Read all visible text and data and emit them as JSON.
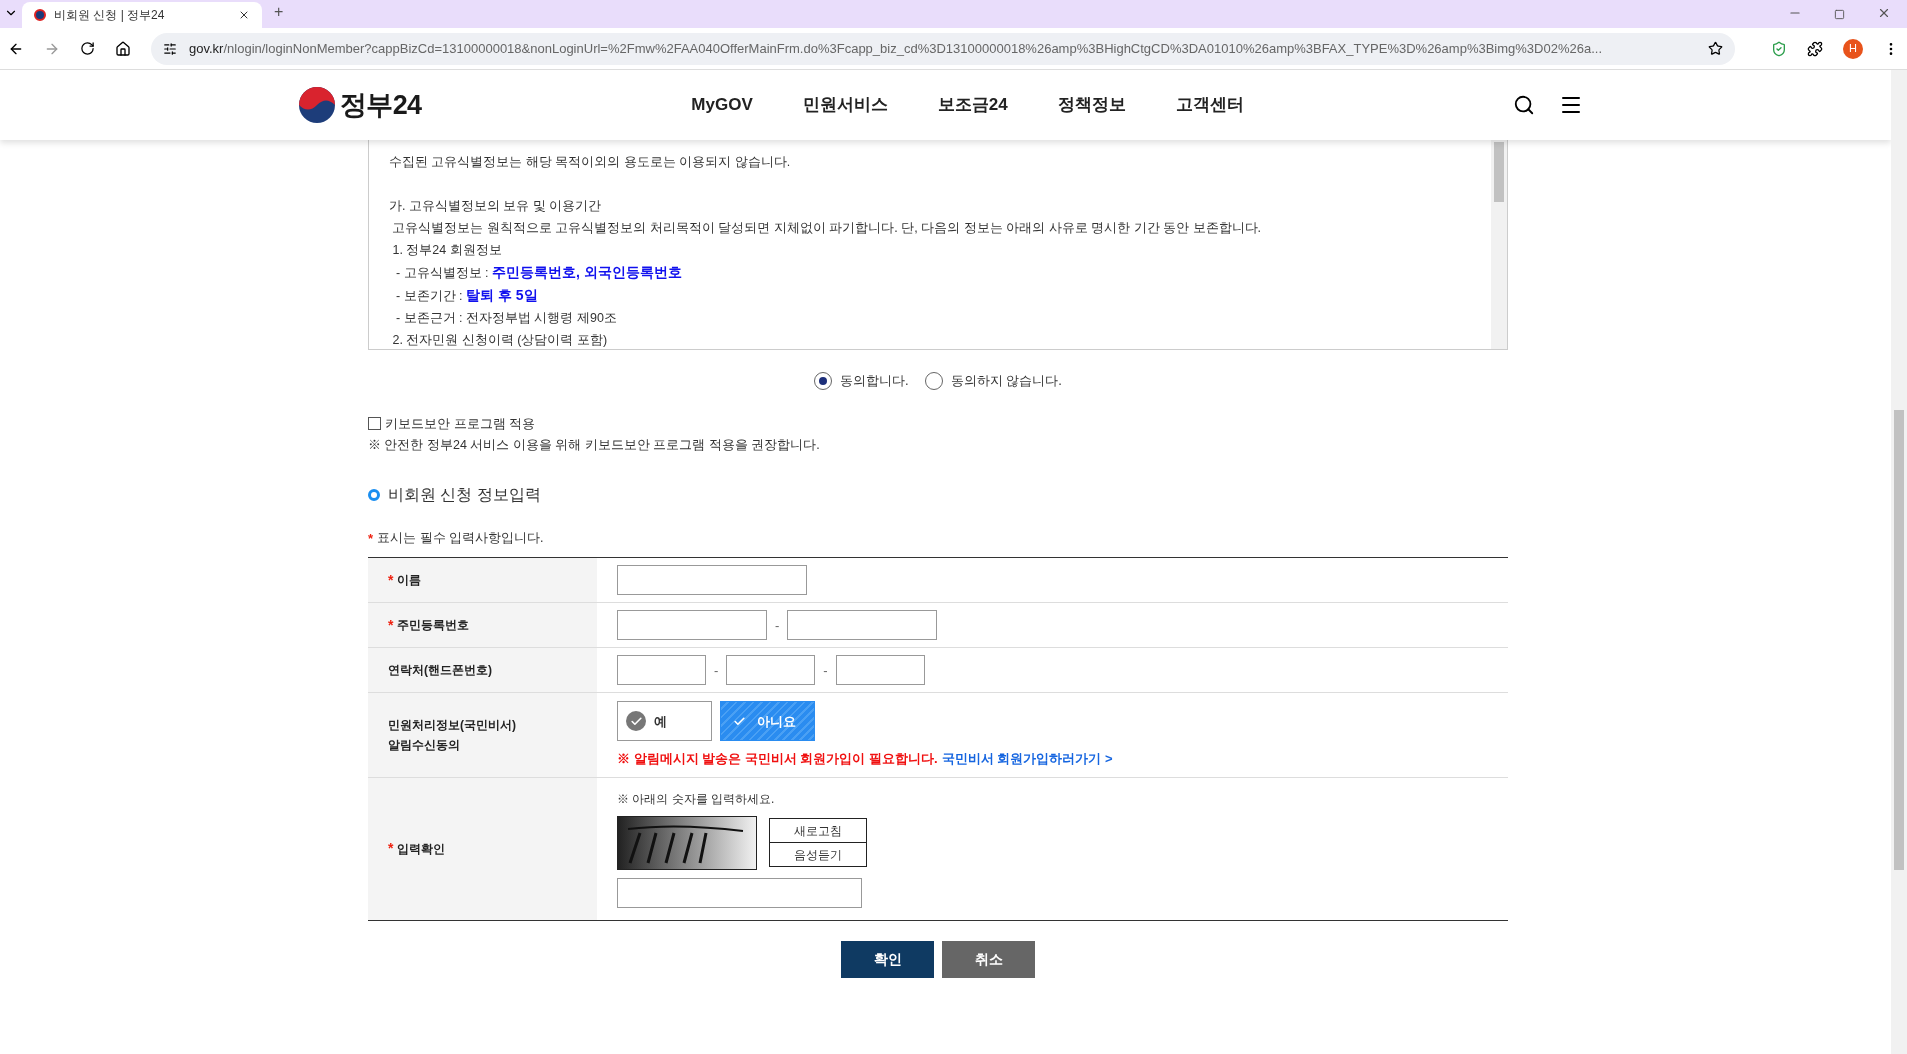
{
  "browser": {
    "tab_title": "비회원 신청 | 정부24",
    "new_tab": "+",
    "url_host": "gov.kr",
    "url_path": "/nlogin/loginNonMember?cappBizCd=13100000018&nonLoginUrl=%2Fmw%2FAA040OfferMainFrm.do%3Fcapp_biz_cd%3D13100000018%26amp%3BHighCtgCD%3DA01010%26amp%3BFAX_TYPE%3D%26amp%3Bimg%3D02%26a...",
    "avatar": "H"
  },
  "header": {
    "logo": "정부24",
    "nav": [
      "MyGOV",
      "민원서비스",
      "보조금24",
      "정책정보",
      "고객센터"
    ]
  },
  "terms": {
    "paragraphs": [
      [
        "수집된 고유식별정보는 해당 목적이외의 용도로는 이용되지 않습니다."
      ],
      [
        "가. 고유식별정보의 보유 및 이용기간",
        " 고유식별정보는 원칙적으로 고유식별정보의 처리목적이 달성되면 지체없이 파기합니다. 단, 다음의 정보는 아래의 사유로 명시한 기간 동안 보존합니다.",
        " 1. 정부24 회원정보",
        "  - 고유식별정보 : **주민등록번호, 외국인등록번호**",
        "  - 보존기간 : **탈퇴 후 5일**",
        "  - 보존근거 : 전자정부법 시행령 제90조",
        " 2. 전자민원 신청이력 (상담이력 포함)"
      ]
    ]
  },
  "consent": [
    {
      "label": "동의합니다.",
      "selected": true
    },
    {
      "label": "동의하지 않습니다.",
      "selected": false
    }
  ],
  "keyboard_security": {
    "label": "키보드보안 프로그램 적용",
    "checked": false,
    "note": "※ 안전한 정부24 서비스 이용을 위해 키보드보안 프로그램 적용을 권장합니다."
  },
  "section_title": "비회원 신청 정보입력",
  "required_note": {
    "mark": "*",
    "text": "표시는 필수 입력사항입니다."
  },
  "form": [
    {
      "kind": "text",
      "mark": "*",
      "label": "이름"
    },
    {
      "kind": "text",
      "mark": "*",
      "label": "주민등록번호",
      "separators": [
        "-"
      ]
    },
    {
      "kind": "phone",
      "label": "연락처(핸드폰번호)",
      "separators": [
        "-",
        "-"
      ]
    },
    {
      "kind": "yes_no",
      "label": "민원처리정보(국민비서) 알림수신동의",
      "options": [
        {
          "label": "예",
          "selected": false
        },
        {
          "label": "아니요",
          "selected": true
        }
      ],
      "warning": "※ 알림메시지 발송은 국민비서 회원가입이 필요합니다.",
      "link": "국민비서 회원가입하러가기 >"
    },
    {
      "kind": "captcha",
      "mark": "*",
      "label": "입력확인",
      "instruction": "※ 아래의 숫자를 입력하세요.",
      "buttons": [
        "새로고침",
        "음성듣기"
      ]
    }
  ],
  "buttons": [
    {
      "label": "확인",
      "kind": "primary"
    },
    {
      "label": "취소",
      "kind": "secondary"
    }
  ]
}
